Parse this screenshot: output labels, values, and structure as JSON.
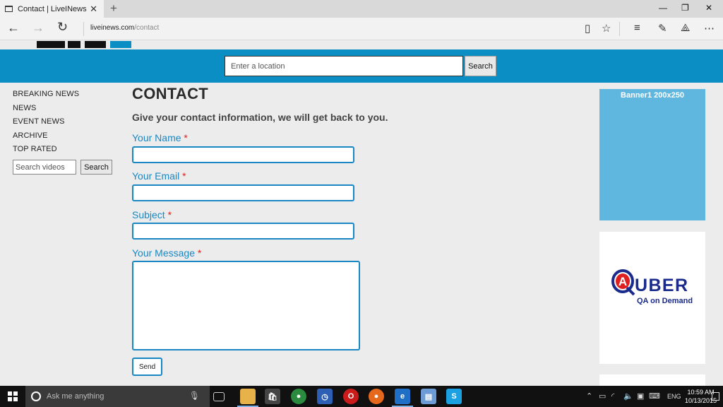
{
  "browser": {
    "tab_title": "Contact | LiveINews",
    "tab_close": "✕",
    "new_tab": "+",
    "address_domain": "liveinews.com",
    "address_path": "/contact"
  },
  "header": {
    "location_placeholder": "Enter a location",
    "search_label": "Search"
  },
  "sidebar": {
    "items": [
      {
        "label": "BREAKING NEWS"
      },
      {
        "label": "NEWS"
      },
      {
        "label": "EVENT NEWS"
      },
      {
        "label": "ARCHIVE"
      },
      {
        "label": "TOP RATED"
      }
    ],
    "video_placeholder": "Search videos",
    "video_search_label": "Search"
  },
  "contact": {
    "title": "CONTACT",
    "intro": "Give your contact information, we will get back to you.",
    "required_mark": "*",
    "name_label": "Your Name",
    "email_label": "Your Email",
    "subject_label": "Subject",
    "message_label": "Your Message",
    "send_label": "Send"
  },
  "banners": {
    "banner1_label": "Banner1 200x250",
    "quber_letter": "A",
    "quber_word": "UBER",
    "quber_tagline": "QA on Demand"
  },
  "taskbar": {
    "search_placeholder": "Ask me anything",
    "language": "ENG",
    "time": "10:59 AM",
    "date": "10/13/2015"
  },
  "colors": {
    "header_blue": "#0a8ec4",
    "form_blue": "#1b87c2",
    "required_red": "#e02020",
    "banner_blue": "#5fb6df"
  }
}
